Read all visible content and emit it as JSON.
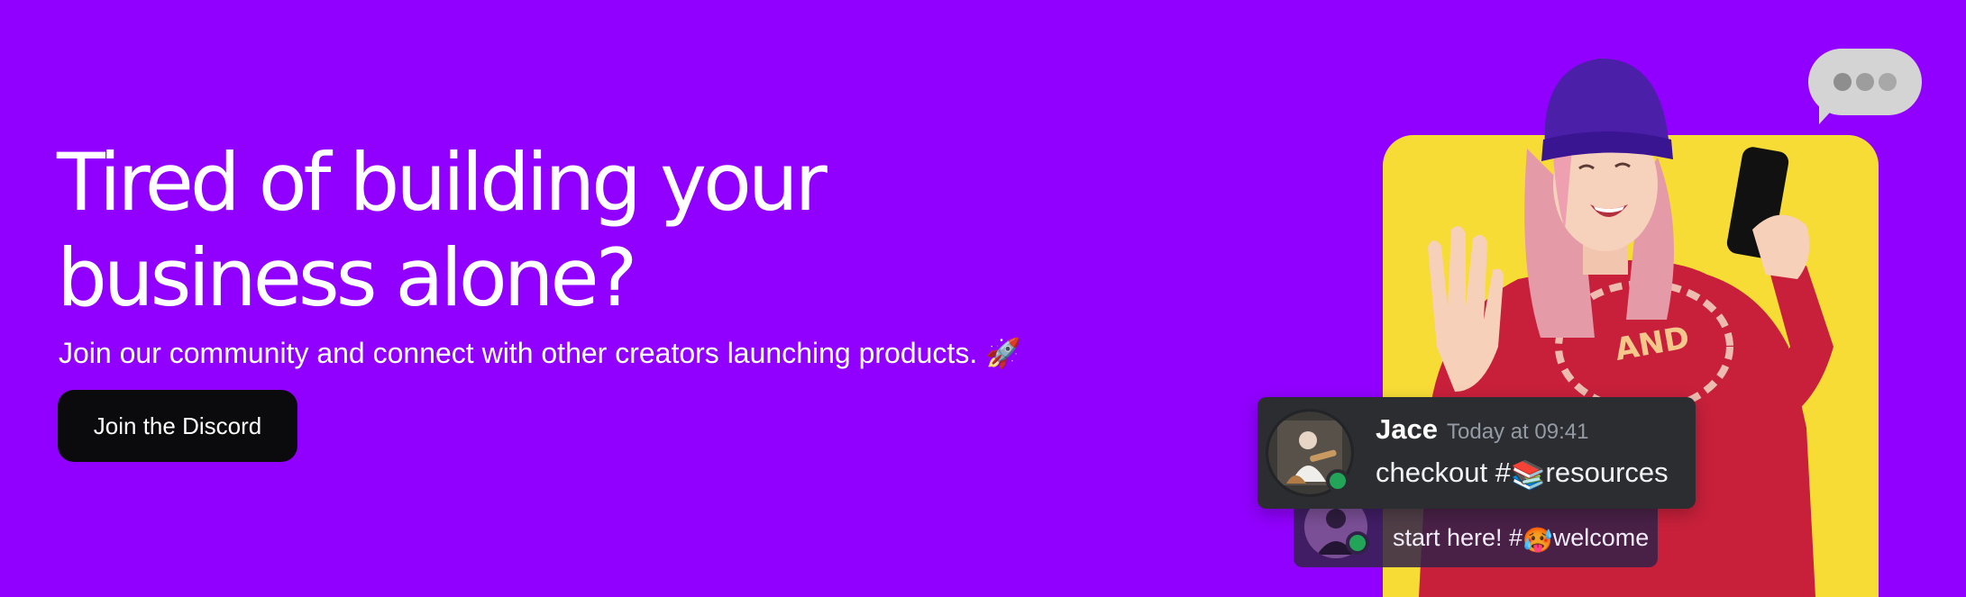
{
  "hero": {
    "headline": "Tired of building your business alone?",
    "subtitle": "Join our community and connect with other creators launching products. 🚀",
    "cta_label": "Join the Discord"
  },
  "chat": {
    "typing_bubble_icon": "typing-dots-icon",
    "front_message": {
      "username": "Jace",
      "timestamp": "Today at 09:41",
      "text_prefix": "checkout #",
      "channel_emoji": "📚",
      "channel": "resources",
      "status": "online"
    },
    "back_message": {
      "text_prefix": "start here! #",
      "channel_emoji": "🥵",
      "channel": "welcome",
      "status": "online"
    }
  },
  "colors": {
    "background": "#9100fe",
    "card": "#f7dc36",
    "button": "#0b0b0d",
    "message_bg": "#2b2d31",
    "online": "#23a559"
  }
}
